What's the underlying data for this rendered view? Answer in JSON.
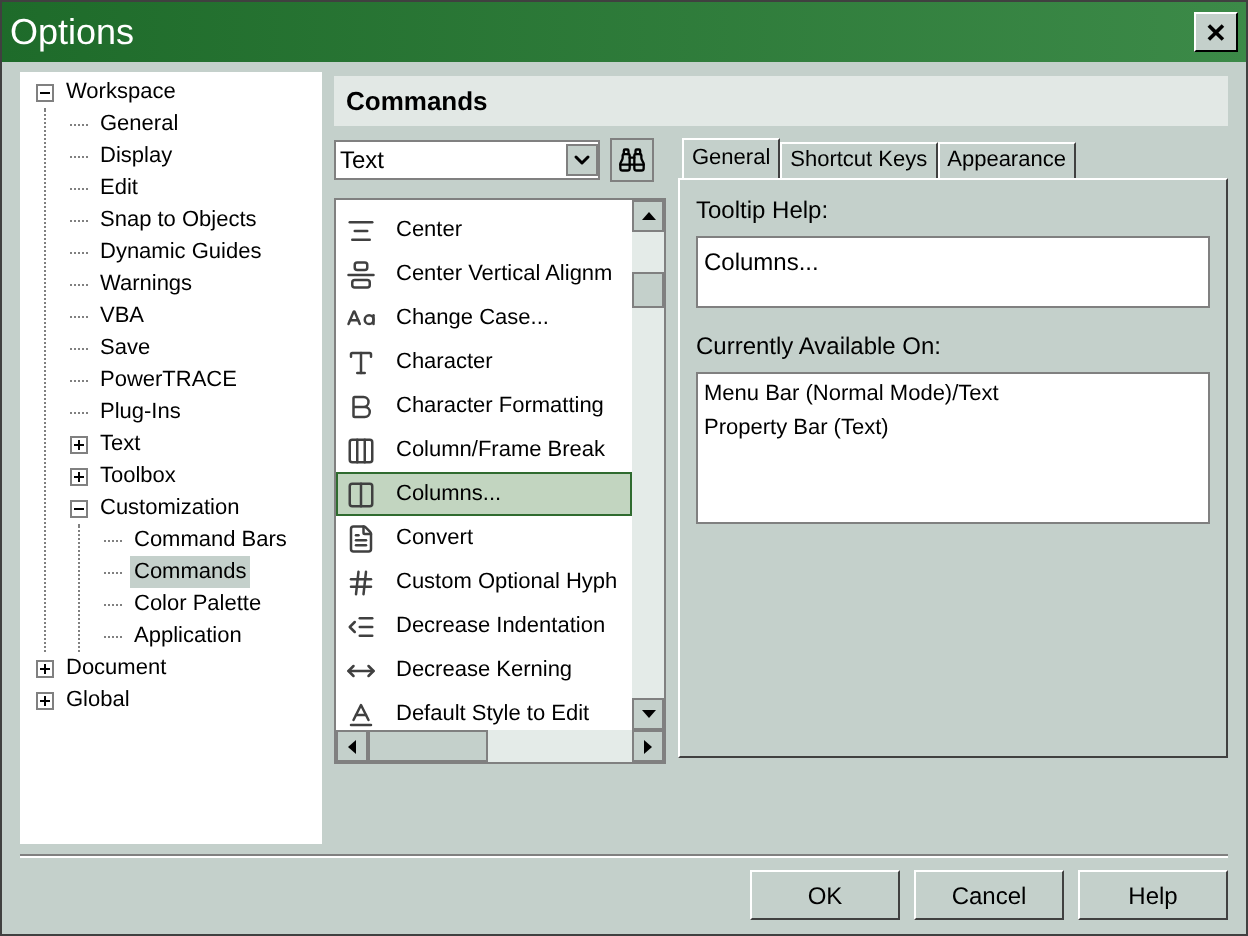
{
  "window": {
    "title": "Options",
    "close": "✕"
  },
  "tree": [
    {
      "label": "Workspace",
      "expanded": true,
      "selected": false,
      "children": [
        {
          "label": "General",
          "selected": false
        },
        {
          "label": "Display",
          "selected": false
        },
        {
          "label": "Edit",
          "selected": false
        },
        {
          "label": "Snap to Objects",
          "selected": false
        },
        {
          "label": "Dynamic Guides",
          "selected": false
        },
        {
          "label": "Warnings",
          "selected": false
        },
        {
          "label": "VBA",
          "selected": false
        },
        {
          "label": "Save",
          "selected": false
        },
        {
          "label": "PowerTRACE",
          "selected": false
        },
        {
          "label": "Plug-Ins",
          "selected": false
        },
        {
          "label": "Text",
          "expanded": false,
          "selected": false
        },
        {
          "label": "Toolbox",
          "expanded": false,
          "selected": false
        },
        {
          "label": "Customization",
          "expanded": true,
          "selected": false,
          "children": [
            {
              "label": "Command Bars",
              "selected": false
            },
            {
              "label": "Commands",
              "selected": true
            },
            {
              "label": "Color Palette",
              "selected": false
            },
            {
              "label": "Application",
              "selected": false
            }
          ]
        }
      ]
    },
    {
      "label": "Document",
      "expanded": false,
      "selected": false
    },
    {
      "label": "Global",
      "expanded": false,
      "selected": false
    }
  ],
  "panel_title": "Commands",
  "category_dropdown": {
    "value": "Text"
  },
  "commands": [
    {
      "label": "Center",
      "selected": false
    },
    {
      "label": "Center Vertical Alignm",
      "selected": false
    },
    {
      "label": "Change Case...",
      "selected": false
    },
    {
      "label": "Character",
      "selected": false
    },
    {
      "label": "Character Formatting",
      "selected": false
    },
    {
      "label": "Column/Frame Break",
      "selected": false
    },
    {
      "label": "Columns...",
      "selected": true
    },
    {
      "label": "Convert",
      "selected": false
    },
    {
      "label": "Custom Optional Hyph",
      "selected": false
    },
    {
      "label": "Decrease Indentation",
      "selected": false
    },
    {
      "label": "Decrease Kerning",
      "selected": false
    },
    {
      "label": "Default Style to Edit",
      "selected": false
    }
  ],
  "tabs": [
    {
      "label": "General",
      "selected": true
    },
    {
      "label": "Shortcut Keys",
      "selected": false
    },
    {
      "label": "Appearance",
      "selected": false
    }
  ],
  "tooltip_help": {
    "label": "Tooltip Help:",
    "value": "Columns..."
  },
  "available_on": {
    "label": "Currently Available On:",
    "lines": [
      "Menu Bar (Normal Mode)/Text",
      "Property Bar (Text)"
    ]
  },
  "buttons": [
    "OK",
    "Cancel",
    "Help"
  ]
}
